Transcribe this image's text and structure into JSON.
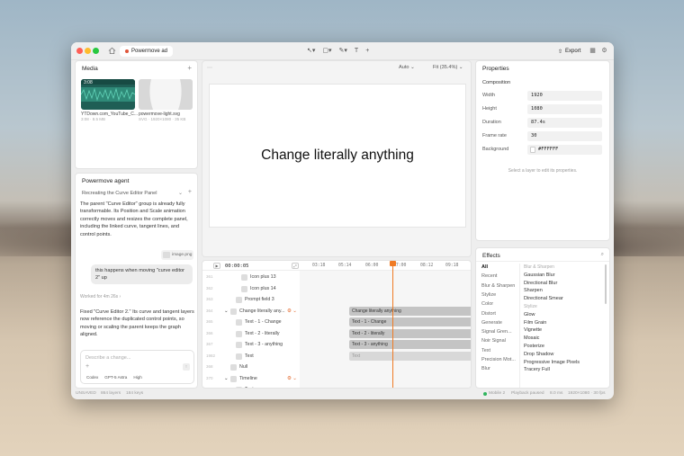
{
  "tab": {
    "title": "Powermove ad"
  },
  "toolbar": {
    "export_label": "Export"
  },
  "media": {
    "title": "Media",
    "items": [
      {
        "duration": "3:08",
        "name": "YTDown.com_YouTube_C...",
        "meta": "3:08 · 8.5 MB"
      },
      {
        "name": "powermove-light.svg",
        "meta": "SVG · 1920×1080 · 35 KB"
      }
    ]
  },
  "agent": {
    "title": "Powermove agent",
    "thread_title": "Recreating the Curve Editor Panel",
    "message1": "The parent \"Curve Editor\" group is already fully transformable. Its Position and Scale animation correctly moves and resizes the complete panel, including the linked curve, tangent lines, and control points.",
    "attachment": "image.png",
    "user_message": "this happens when moving \"curve editor 2\" up",
    "worked_for": "Worked for 4m 26s",
    "message2": "Fixed \"Curve Editor 2.\" Its curve and tangent layers now reference the duplicated control points, so moving or scaling the parent keeps the graph aligned.",
    "input_placeholder": "Describe a change...",
    "chips": [
      "Codex",
      "GPT-5 Astra",
      "High"
    ]
  },
  "canvas": {
    "zoom_mode": "Auto",
    "fit_label": "Fit (35.4%)",
    "stage_text": "Change literally anything"
  },
  "properties": {
    "title": "Properties",
    "section": "Composition",
    "rows": [
      {
        "label": "Width",
        "value": "1920"
      },
      {
        "label": "Height",
        "value": "1080"
      },
      {
        "label": "Duration",
        "value": "87.4s"
      },
      {
        "label": "Frame rate",
        "value": "30"
      },
      {
        "label": "Background",
        "value": "#FFFFFF"
      }
    ],
    "hint": "Select a layer to edit its properties."
  },
  "effects": {
    "title": "Effects",
    "categories": [
      "All",
      "Recent",
      "Blur & Sharpen",
      "Stylize",
      "Color",
      "Distort",
      "Generate",
      "Signal Gren...",
      "Noir Signal",
      "Text",
      "Precision Mot...",
      "Blur"
    ],
    "group1_header": "Blur & Sharpen",
    "group1": [
      "Gaussian Blur",
      "Directional Blur",
      "Sharpen",
      "Directional Smear"
    ],
    "group2_header": "Stylize",
    "group2": [
      "Glow",
      "Film Grain",
      "Vignette",
      "Mosaic",
      "Posterize",
      "Drop Shadow",
      "Progressive Image Pixels",
      "Tracery Full"
    ]
  },
  "timeline": {
    "timecode": "00:00:05",
    "ruler": [
      "03:18",
      "05:14",
      "06:00",
      "07:00",
      "08:12",
      "09:18"
    ],
    "layers": [
      {
        "num": "361",
        "name": "Icon plus 13"
      },
      {
        "num": "362",
        "name": "Icon plus 14"
      },
      {
        "num": "363",
        "name": "Prompt field 3"
      },
      {
        "num": "364",
        "name": "Change literally any..."
      },
      {
        "num": "365",
        "name": "Text - 1 - Change"
      },
      {
        "num": "366",
        "name": "Text - 2 - literally"
      },
      {
        "num": "367",
        "name": "Text - 3 - anything"
      },
      {
        "num": "1982",
        "name": "Text"
      },
      {
        "num": "368",
        "name": "Null"
      },
      {
        "num": "370",
        "name": "Timeline"
      },
      {
        "num": "228",
        "name": "Text"
      }
    ],
    "clips": [
      "Change literally anything",
      "Text - 1 - Change",
      "Text - 2 - literally",
      "Text - 3 - anything",
      "Text"
    ]
  },
  "status": {
    "left": [
      "UNSAVED",
      "864 layers",
      "184 keys"
    ],
    "right": [
      "Mobile 2",
      "Playback paused",
      "8.0 ms",
      "1920×1080 · 30 fps"
    ]
  }
}
